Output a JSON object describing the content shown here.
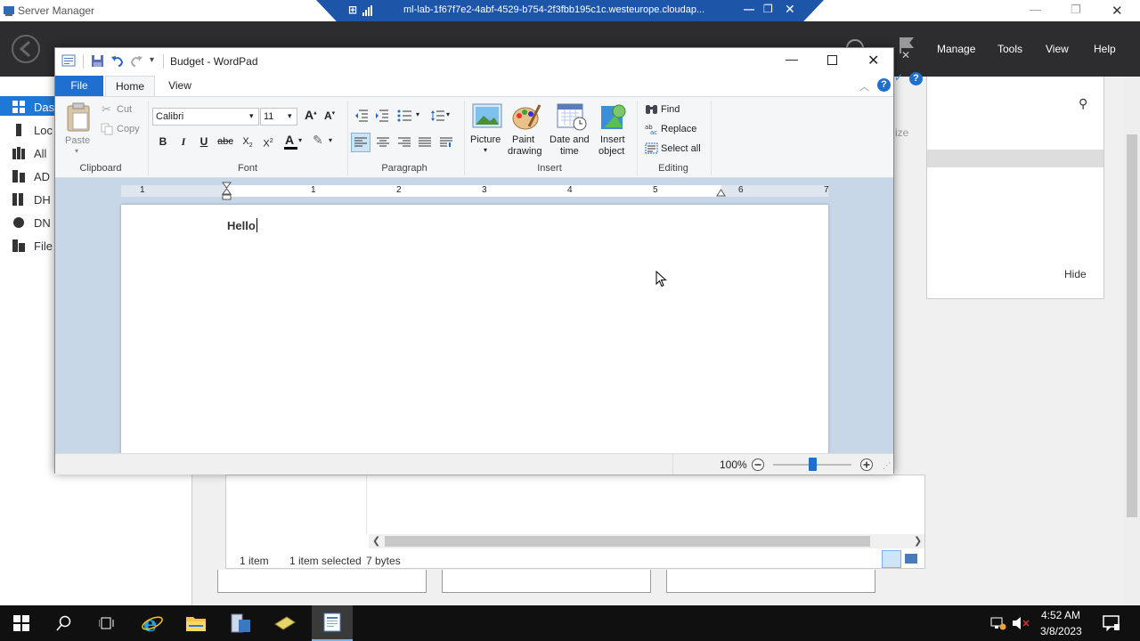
{
  "server_manager": {
    "title": "Server Manager",
    "menu": [
      "Manage",
      "Tools",
      "View",
      "Help"
    ],
    "sidebar": [
      {
        "label": "Das",
        "icon": "dashboard-icon"
      },
      {
        "label": "Loc",
        "icon": "local-server-icon"
      },
      {
        "label": "All",
        "icon": "all-servers-icon"
      },
      {
        "label": "AD",
        "icon": "ad-icon"
      },
      {
        "label": "DH",
        "icon": "dhcp-icon"
      },
      {
        "label": "DN",
        "icon": "dns-icon"
      },
      {
        "label": "File",
        "icon": "file-services-icon"
      }
    ],
    "right_panel": {
      "customize": "ize",
      "hide": "Hide"
    }
  },
  "rdp_bar": {
    "host": "ml-lab-1f67f7e2-4abf-4529-b754-2f3fbb195c1c.westeurope.cloudap..."
  },
  "explorer_status": {
    "items": "1 item",
    "selected": "1 item selected",
    "size": "7 bytes"
  },
  "wordpad": {
    "title": "Budget - WordPad",
    "tabs": {
      "file": "File",
      "home": "Home",
      "view": "View"
    },
    "clipboard": {
      "paste": "Paste",
      "cut": "Cut",
      "copy": "Copy",
      "group": "Clipboard"
    },
    "font": {
      "family": "Calibri",
      "size": "11",
      "group": "Font"
    },
    "paragraph": {
      "group": "Paragraph"
    },
    "insert": {
      "picture": "Picture",
      "paint_1": "Paint",
      "paint_2": "drawing",
      "date_1": "Date and",
      "date_2": "time",
      "object_1": "Insert",
      "object_2": "object",
      "group": "Insert"
    },
    "editing": {
      "find": "Find",
      "replace": "Replace",
      "select_all": "Select all",
      "group": "Editing"
    },
    "ruler_numbers": [
      "1",
      "1",
      "2",
      "3",
      "4",
      "5",
      "6",
      "7"
    ],
    "document_text": "Hello",
    "zoom": "100%",
    "zoom_level": 0.5
  },
  "taskbar": {
    "time": "4:52 AM",
    "date": "3/8/2023"
  }
}
